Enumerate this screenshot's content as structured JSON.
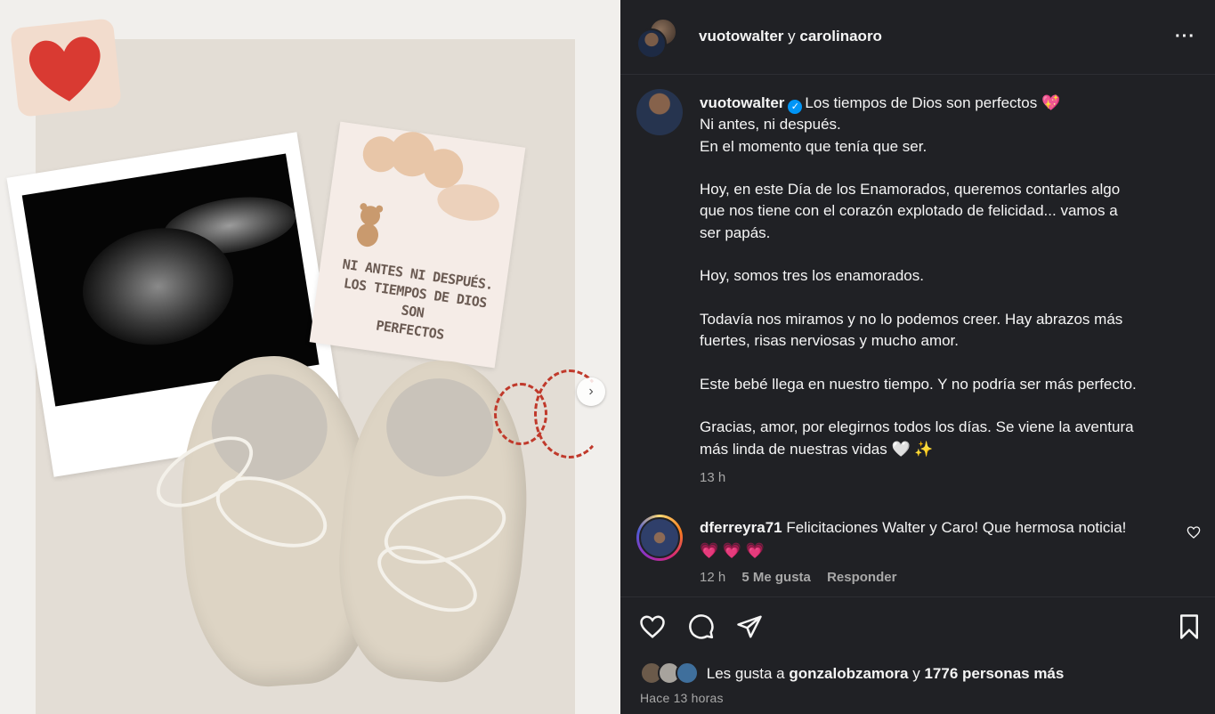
{
  "post": {
    "image_alt": "Ecografía, tarjeta y zapatitos de bebé",
    "card_text": "NI ANTES NI DESPUÉS.\nLOS TIEMPOS DE DIOS SON\nPERFECTOS",
    "next_icon": "chevron-right-icon"
  },
  "header": {
    "user1": "vuotowalter",
    "connector": " y ",
    "user2": "carolinaoro",
    "more_icon": "more-horizontal-icon"
  },
  "caption": {
    "username": "vuotowalter",
    "first_line_text": "Los tiempos de Dios son perfectos",
    "first_line_emoji": "💖",
    "lines": [
      "Ni antes, ni después.",
      "En el momento que tenía que ser.",
      "",
      "Hoy, en este Día de los Enamorados, queremos contarles algo",
      "que nos tiene con el corazón explotado de felicidad... vamos a",
      "ser papás.",
      "",
      "Hoy, somos tres los enamorados.",
      "",
      "Todavía nos miramos y no lo podemos creer. Hay abrazos más",
      "fuertes, risas nerviosas y mucho amor.",
      "",
      "Este bebé llega en nuestro tiempo. Y no podría ser más perfecto.",
      "",
      "Gracias, amor, por elegirnos todos los días. Se viene la aventura"
    ],
    "last_line_text": "más linda de nuestras vidas",
    "last_line_emoji1": "🤍",
    "last_line_emoji2": "✨",
    "time": "13 h"
  },
  "comment": {
    "username": "dferreyra71",
    "text": "Felicitaciones Walter y Caro! Que hermosa noticia!",
    "emojis": "💗 💗 💗",
    "time": "12 h",
    "likes": "5 Me gusta",
    "reply": "Responder"
  },
  "actions": {
    "likes_prefix": "Les gusta a",
    "likes_user": "gonzalobzamora",
    "likes_connector": "y",
    "likes_count": "1776 personas más",
    "time_ago": "Hace 13 horas"
  }
}
